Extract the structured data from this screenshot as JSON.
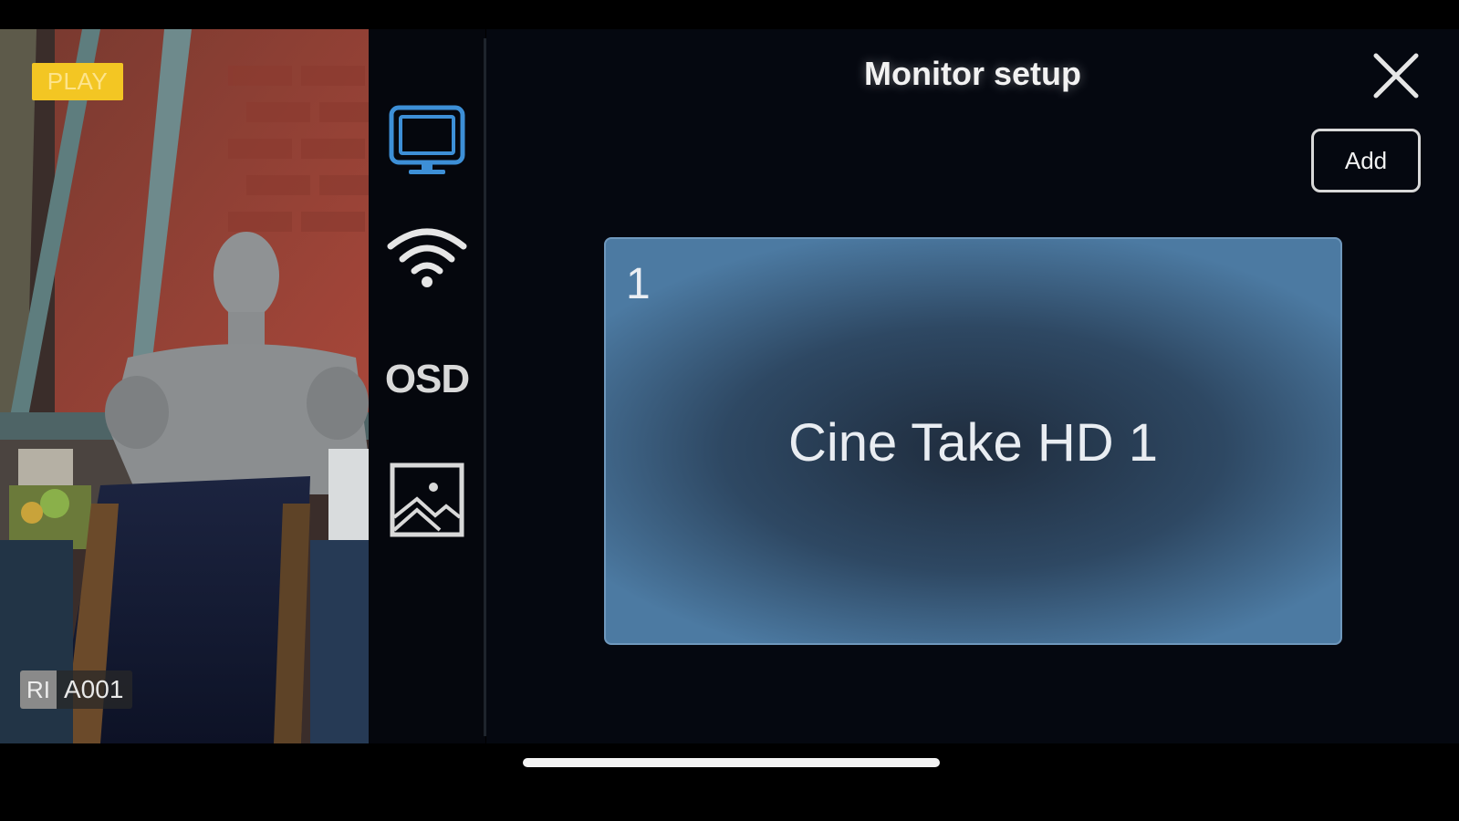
{
  "preview": {
    "status_badge": "PLAY",
    "clip_prefix": "RI",
    "clip_id": "A001"
  },
  "sidebar": {
    "items": [
      {
        "icon": "monitor-icon",
        "active": true
      },
      {
        "icon": "wifi-icon",
        "active": false
      },
      {
        "icon": "osd-icon",
        "label": "OSD",
        "active": false
      },
      {
        "icon": "image-icon",
        "active": false
      }
    ],
    "active_color": "#3d8fd6"
  },
  "header": {
    "title": "Monitor setup",
    "add_label": "Add"
  },
  "monitors": [
    {
      "index": "1",
      "name": "Cine Take HD 1"
    }
  ]
}
